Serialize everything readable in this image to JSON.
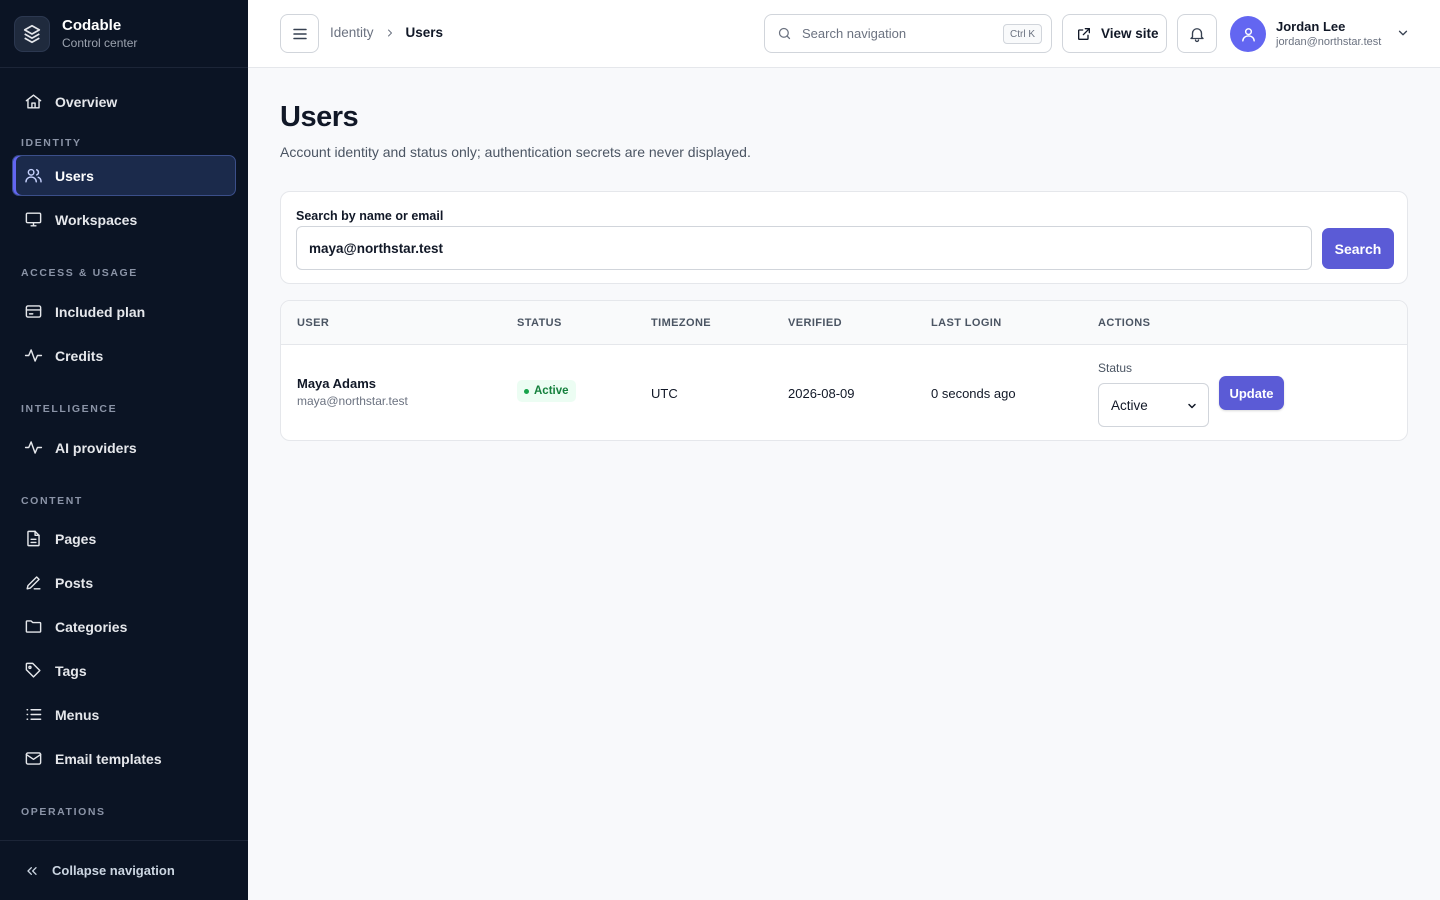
{
  "brand": {
    "name": "Codable",
    "subtitle": "Control center"
  },
  "sidebar": {
    "overview": "Overview",
    "sections": {
      "identity": "IDENTITY",
      "access": "ACCESS & USAGE",
      "intelligence": "INTELLIGENCE",
      "content": "CONTENT",
      "operations": "OPERATIONS"
    },
    "items": {
      "users": "Users",
      "workspaces": "Workspaces",
      "included_plan": "Included plan",
      "credits": "Credits",
      "ai_providers": "AI providers",
      "pages": "Pages",
      "posts": "Posts",
      "categories": "Categories",
      "tags": "Tags",
      "menus": "Menus",
      "email_templates": "Email templates"
    },
    "collapse_label": "Collapse navigation"
  },
  "topbar": {
    "breadcrumb_parent": "Identity",
    "breadcrumb_current": "Users",
    "search_placeholder": "Search navigation",
    "shortcut": "Ctrl K",
    "view_site": "View site",
    "user_name": "Jordan Lee",
    "user_email": "jordan@northstar.test"
  },
  "page": {
    "title": "Users",
    "subtitle": "Account identity and status only; authentication secrets are never displayed."
  },
  "search": {
    "label": "Search by name or email",
    "value": "maya@northstar.test",
    "button": "Search"
  },
  "table": {
    "columns": [
      "USER",
      "STATUS",
      "TIMEZONE",
      "VERIFIED",
      "LAST LOGIN",
      "ACTIONS"
    ],
    "rows": [
      {
        "name": "Maya Adams",
        "email": "maya@northstar.test",
        "status": "Active",
        "timezone": "UTC",
        "verified": "2026-08-09",
        "last_login": "0 seconds ago",
        "action_label": "Status",
        "action_value": "Active",
        "action_button": "Update"
      }
    ]
  },
  "colors": {
    "accent": "#5b5bd6",
    "sidebar_bg": "#0b1424",
    "success": "#15803d"
  }
}
